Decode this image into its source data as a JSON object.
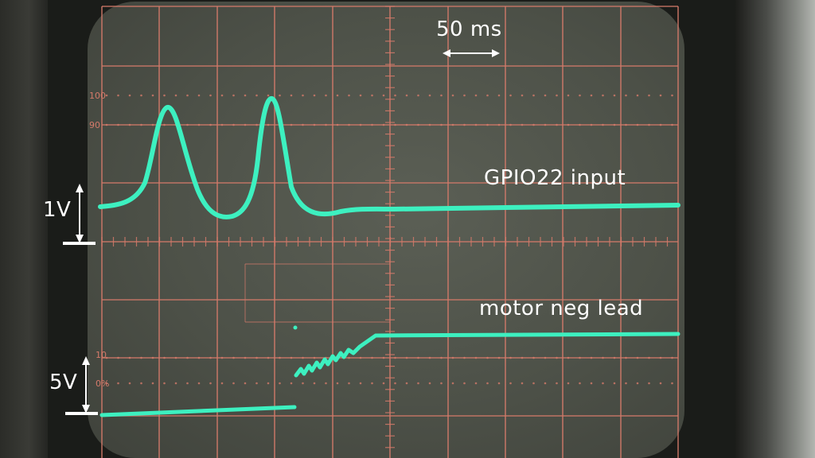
{
  "annotations": {
    "time_scale": "50 ms",
    "channel1_label": "GPIO22 input",
    "channel2_label": "motor neg lead",
    "channel1_scale": "1V",
    "channel2_scale": "5V"
  },
  "graticule_marks": {
    "top_100": "100",
    "top_90": "90",
    "bottom_10": "10",
    "bottom_0": "0%"
  },
  "colors": {
    "trace": "#3df0c0",
    "graticule": "#d47a6a",
    "screen": "#4d5148",
    "annotation": "#ffffff"
  }
}
